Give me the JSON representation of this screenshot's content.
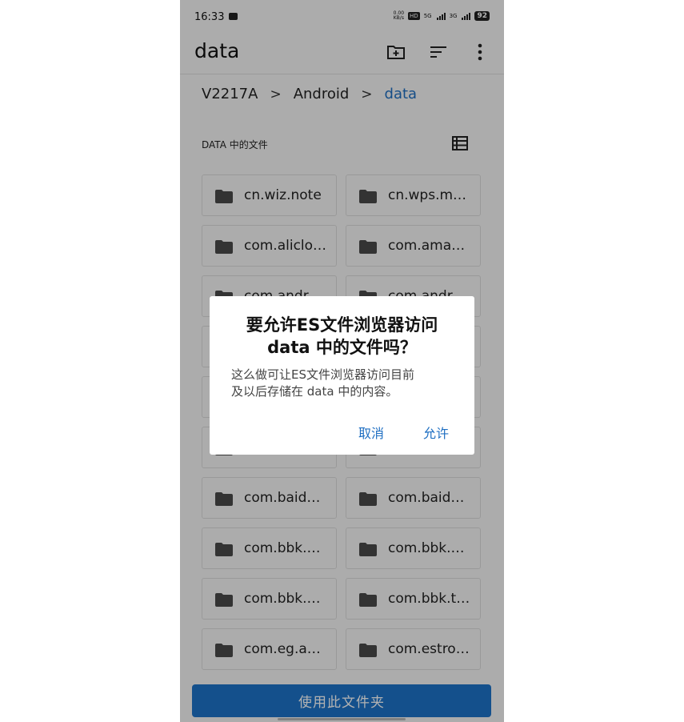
{
  "status_bar": {
    "time": "16:33",
    "net_speed_top": "0.00",
    "net_speed_bottom": "KB/s",
    "hd_label": "HD",
    "net1": "5G",
    "net2": "3G",
    "battery": "92"
  },
  "app_bar": {
    "title": "data",
    "icons": [
      "new-folder-icon",
      "sort-icon",
      "more-vert-icon"
    ]
  },
  "breadcrumb": {
    "items": [
      "V2217A",
      "Android",
      "data"
    ],
    "separator": ">"
  },
  "section": {
    "title": "DATA 中的文件"
  },
  "folders": [
    "cn.wiz.note",
    "cn.wps.m…",
    "com.aliclo…",
    "com.ama…",
    "com.andr…",
    "com.andr…",
    "",
    "",
    "",
    "",
    "",
    "",
    "com.baid…",
    "com.baid…",
    "com.bbk.…",
    "com.bbk.…",
    "com.bbk.…",
    "com.bbk.t…",
    "com.eg.a…",
    "com.estro…"
  ],
  "use_folder_button": "使用此文件夹",
  "dialog": {
    "title_line1": "要允许ES文件浏览器访问",
    "title_line2": "data 中的文件吗？",
    "message_line1": "这么做可让ES文件浏览器访问目前",
    "message_line2": "及以后存储在 data 中的内容。",
    "cancel": "取消",
    "allow": "允许"
  },
  "colors": {
    "accent": "#1d73c9",
    "link": "#1f6fc2"
  }
}
